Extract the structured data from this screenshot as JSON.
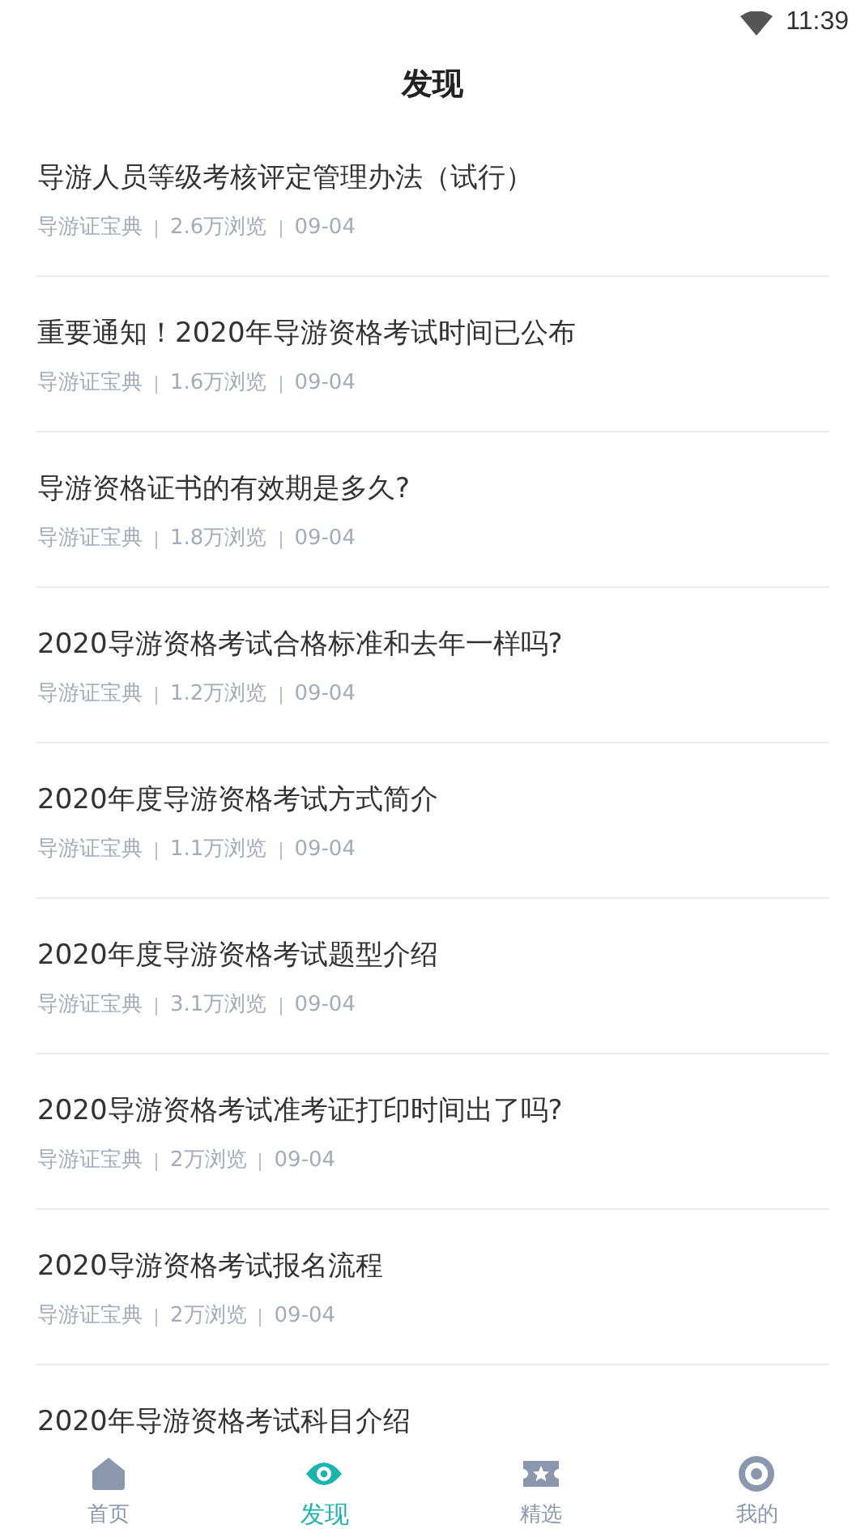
{
  "status_bar": {
    "time": "11:39"
  },
  "header": {
    "title": "发现"
  },
  "articles": [
    {
      "title": "导游人员等级考核评定管理办法（试行）",
      "source": "导游证宝典",
      "views": "2.6万浏览",
      "date": "09-04"
    },
    {
      "title": "重要通知！2020年导游资格考试时间已公布",
      "source": "导游证宝典",
      "views": "1.6万浏览",
      "date": "09-04"
    },
    {
      "title": "导游资格证书的有效期是多久?",
      "source": "导游证宝典",
      "views": "1.8万浏览",
      "date": "09-04"
    },
    {
      "title": "2020导游资格考试合格标准和去年一样吗?",
      "source": "导游证宝典",
      "views": "1.2万浏览",
      "date": "09-04"
    },
    {
      "title": "2020年度导游资格考试方式简介",
      "source": "导游证宝典",
      "views": "1.1万浏览",
      "date": "09-04"
    },
    {
      "title": "2020年度导游资格考试题型介绍",
      "source": "导游证宝典",
      "views": "3.1万浏览",
      "date": "09-04"
    },
    {
      "title": "2020导游资格考试准考证打印时间出了吗?",
      "source": "导游证宝典",
      "views": "2万浏览",
      "date": "09-04"
    },
    {
      "title": "2020导游资格考试报名流程",
      "source": "导游证宝典",
      "views": "2万浏览",
      "date": "09-04"
    },
    {
      "title": "2020年导游资格考试科目介绍"
    }
  ],
  "tab_bar": [
    {
      "kind": "home",
      "label": "首页",
      "selected": false
    },
    {
      "kind": "discover",
      "label": "发现",
      "selected": true
    },
    {
      "kind": "featured",
      "label": "精选",
      "selected": false
    },
    {
      "kind": "profile",
      "label": "我的",
      "selected": false
    }
  ]
}
